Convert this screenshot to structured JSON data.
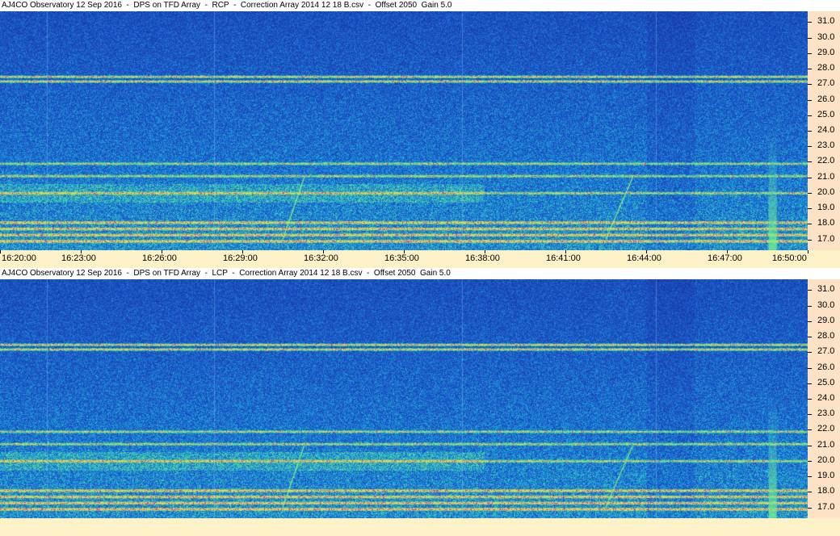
{
  "colors": {
    "background_low": "#1f3db5",
    "background_mid": "#2a62d8",
    "band_hot": "#f2d94c",
    "band_warm": "#4fe0c0",
    "axis_bg": "#fde2c5",
    "footer_bg": "#fdf1c8"
  },
  "chart_data": [
    {
      "type": "heatmap",
      "title": "AJ4CO Observatory 12 Sep 2016  -  DPS on TFD Array  -  RCP  -  Correction Array 2014 12 18 B.csv  -  Offset 2050  Gain 5.0",
      "x_tick_labels": [
        "16:20:00",
        "16:23:00",
        "16:26:00",
        "16:29:00",
        "16:32:00",
        "16:35:00",
        "16:38:00",
        "16:41:00",
        "16:44:00",
        "16:47:00",
        "16:50:00"
      ],
      "y_tick_labels": [
        "31.0",
        "30.0",
        "29.0",
        "28.0",
        "27.0",
        "26.0",
        "25.0",
        "24.0",
        "23.0",
        "22.0",
        "21.0",
        "20.0",
        "19.0",
        "18.0",
        "17.0"
      ],
      "y_values": [
        31,
        30,
        29,
        28,
        27,
        26,
        25,
        24,
        23,
        22,
        21,
        20,
        19,
        18,
        17
      ],
      "ylim": [
        16.3,
        31.7
      ],
      "xlim_minutes": [
        0,
        30
      ],
      "horizontal_bands_mhz": [
        27.2,
        27.5,
        21.9,
        21.1,
        20.0,
        18.1,
        17.7,
        17.3,
        16.9
      ],
      "vertical_event_minutes": [
        28.7
      ],
      "drift_lines": [
        [
          10.5,
          17.0,
          11.3,
          21.0
        ],
        [
          22.5,
          17.0,
          23.5,
          21.0
        ]
      ]
    },
    {
      "type": "heatmap",
      "title": "AJ4CO Observatory 12 Sep 2016  -  DPS on TFD Array  -  LCP  -  Correction Array 2014 12 18 B.csv  -  Offset 2050  Gain 5.0",
      "x_tick_labels": [],
      "y_tick_labels": [
        "31.0",
        "30.0",
        "29.0",
        "28.0",
        "27.0",
        "26.0",
        "25.0",
        "24.0",
        "23.0",
        "22.0",
        "21.0",
        "20.0",
        "19.0",
        "18.0",
        "17.0"
      ],
      "y_values": [
        31,
        30,
        29,
        28,
        27,
        26,
        25,
        24,
        23,
        22,
        21,
        20,
        19,
        18,
        17
      ],
      "ylim": [
        16.3,
        31.7
      ],
      "xlim_minutes": [
        0,
        30
      ],
      "horizontal_bands_mhz": [
        27.2,
        27.5,
        21.9,
        21.1,
        20.0,
        18.1,
        17.7,
        17.3,
        16.9
      ],
      "vertical_event_minutes": [
        28.7
      ],
      "drift_lines": [
        [
          10.5,
          17.0,
          11.3,
          21.0
        ],
        [
          22.5,
          17.0,
          23.5,
          21.0
        ]
      ]
    }
  ]
}
